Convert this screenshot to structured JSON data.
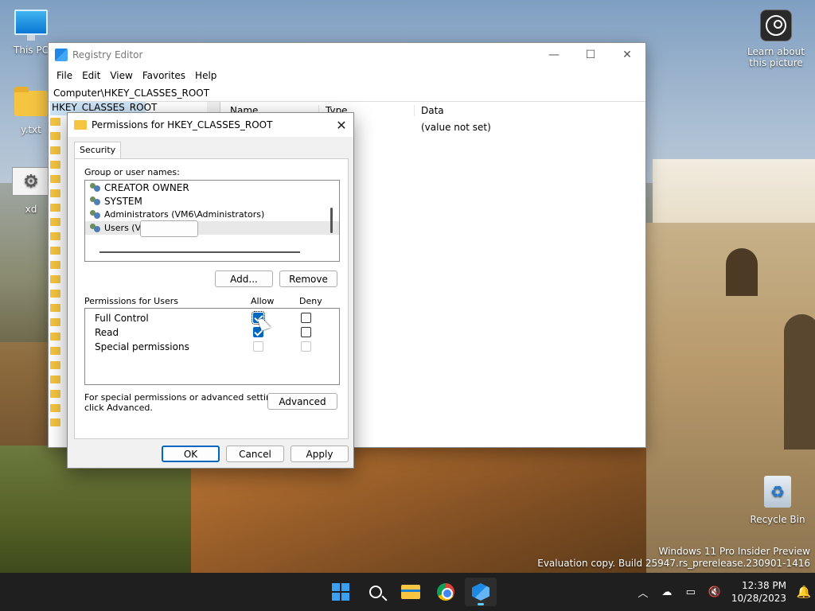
{
  "desktop": {
    "icons": [
      {
        "label": "This PC"
      },
      {
        "label": "y.txt"
      },
      {
        "label": "xd"
      }
    ],
    "learn": {
      "line1": "Learn about",
      "line2": "this picture"
    },
    "recycle": {
      "label": "Recycle Bin"
    },
    "watermark": {
      "line1": "Windows 11 Pro Insider Preview",
      "line2": "Evaluation copy. Build 25947.rs_prerelease.230901-1416"
    }
  },
  "regedit": {
    "title": "Registry Editor",
    "menu": [
      "File",
      "Edit",
      "View",
      "Favorites",
      "Help"
    ],
    "address": "Computer\\HKEY_CLASSES_ROOT",
    "tree_selected": "HKEY_CLASSES_ROOT",
    "columns": [
      "Name",
      "Type",
      "Data"
    ],
    "rows": [
      {
        "data": "(value not set)"
      }
    ]
  },
  "dialog": {
    "title": "Permissions for HKEY_CLASSES_ROOT",
    "tab": "Security",
    "group_label": "Group or user names:",
    "users": [
      "CREATOR OWNER",
      "SYSTEM",
      "Administrators (VM6\\Administrators)",
      "Users (VM6\\Users)"
    ],
    "add_label": "Add...",
    "remove_label": "Remove",
    "perm_label": "Permissions for Users",
    "allow_label": "Allow",
    "deny_label": "Deny",
    "permissions": [
      {
        "name": "Full Control",
        "allow": true,
        "deny": false
      },
      {
        "name": "Read",
        "allow": true,
        "deny": false
      },
      {
        "name": "Special permissions",
        "allow": false,
        "deny": false
      }
    ],
    "advanced_text_1": "For special permissions or advanced settings,",
    "advanced_text_2": "click Advanced.",
    "advanced_label": "Advanced",
    "ok_label": "OK",
    "cancel_label": "Cancel",
    "apply_label": "Apply"
  },
  "taskbar": {
    "time": "12:38 PM",
    "date": "10/28/2023"
  },
  "colors": {
    "accent": "#0067c0",
    "taskbar": "#1f1f1f"
  }
}
